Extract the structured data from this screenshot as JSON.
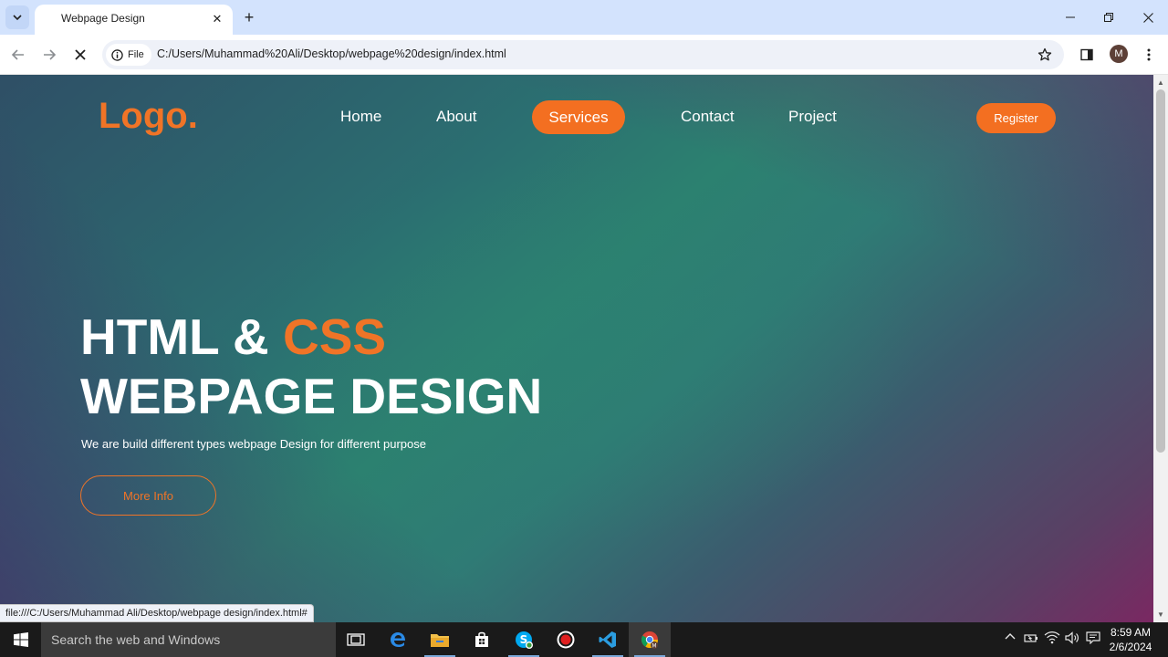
{
  "browser": {
    "tab_title": "Webpage Design",
    "site_chip": "File",
    "url": "C:/Users/Muhammad%20Ali/Desktop/webpage%20design/index.html",
    "profile_initial": "M",
    "status_url": "file:///C:/Users/Muhammad Ali/Desktop/webpage design/index.html#"
  },
  "page": {
    "logo": "Logo.",
    "nav": [
      "Home",
      "About",
      "Services",
      "Contact",
      "Project"
    ],
    "active_nav": "Services",
    "register_label": "Register",
    "hero_line1_prefix": "HTML & ",
    "hero_line1_accent": "CSS",
    "hero_line2": "WEBPAGE DESIGN",
    "hero_subtitle": "We are build different types webpage Design for different purpose",
    "more_info_label": "More Info",
    "accent_color": "#f36f21"
  },
  "taskbar": {
    "search_placeholder": "Search the web and Windows",
    "time": "8:59 AM",
    "date": "2/6/2024",
    "apps": [
      "task-view-icon",
      "edge-icon",
      "file-explorer-icon",
      "store-icon",
      "skype-icon",
      "recorder-icon",
      "vscode-icon",
      "chrome-icon"
    ]
  }
}
